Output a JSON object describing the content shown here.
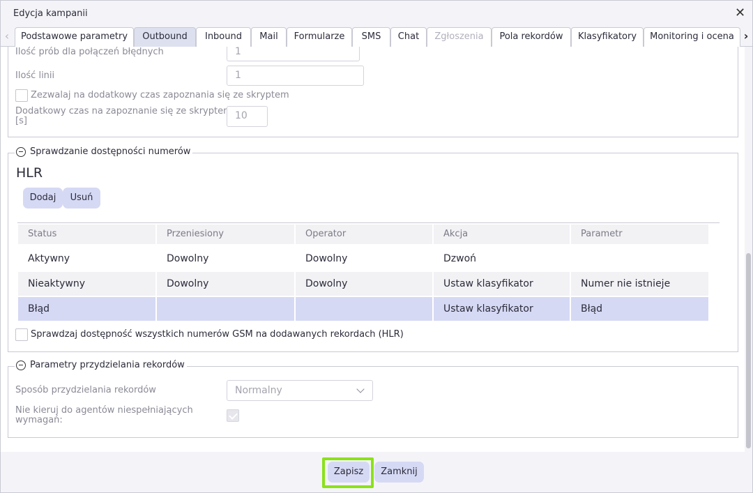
{
  "dialog": {
    "title": "Edycja kampanii"
  },
  "tabs": [
    {
      "label": "Podstawowe parametry",
      "state": "normal"
    },
    {
      "label": "Outbound",
      "state": "active"
    },
    {
      "label": "Inbound",
      "state": "normal"
    },
    {
      "label": "Mail",
      "state": "normal"
    },
    {
      "label": "Formularze",
      "state": "normal"
    },
    {
      "label": "SMS",
      "state": "normal"
    },
    {
      "label": "Chat",
      "state": "normal"
    },
    {
      "label": "Zgłoszenia",
      "state": "disabled"
    },
    {
      "label": "Pola rekordów",
      "state": "normal"
    },
    {
      "label": "Klasyfikatory",
      "state": "normal"
    },
    {
      "label": "Monitoring i ocena",
      "state": "normal"
    }
  ],
  "section1": {
    "fields": [
      {
        "label": "Ilość prób dla połączeń błędnych",
        "value": "1"
      },
      {
        "label": "Ilość linii",
        "value": "1"
      }
    ],
    "allow_extra_time": {
      "label": "Zezwalaj na dodatkowy czas zapoznania się ze skryptem",
      "checked": false
    },
    "extra_time": {
      "label_line1": "Dodatkowy czas na zapoznanie się ze skryptem",
      "label_line2": "[s]",
      "value": "10"
    }
  },
  "hlr_section": {
    "legend": "Sprawdzanie dostępności numerów",
    "heading": "HLR",
    "add_label": "Dodaj",
    "remove_label": "Usuń",
    "columns": [
      "Status",
      "Przeniesiony",
      "Operator",
      "Akcja",
      "Parametr"
    ],
    "rows": [
      {
        "cells": [
          "Aktywny",
          "Dowolny",
          "Dowolny",
          "Dzwoń",
          ""
        ],
        "style": "plain"
      },
      {
        "cells": [
          "Nieaktywny",
          "Dowolny",
          "Dowolny",
          "Ustaw klasyfikator",
          "Numer nie istnieje"
        ],
        "style": "gray"
      },
      {
        "cells": [
          "Błąd",
          "",
          "",
          "Ustaw klasyfikator",
          "Błąd"
        ],
        "style": "selected"
      }
    ],
    "check_all": {
      "label": "Sprawdzaj dostępność wszystkich numerów GSM na dodawanych rekordach (HLR)",
      "checked": false
    }
  },
  "assign_section": {
    "legend": "Parametry przydzielania rekordów",
    "method_label": "Sposób przydzielania rekordów",
    "method_value": "Normalny",
    "no_route_label_line1": "Nie kieruj do agentów niespełniających",
    "no_route_label_line2": "wymagań:",
    "no_route_checked": true
  },
  "footer": {
    "save_label": "Zapisz",
    "close_label": "Zamknij"
  }
}
